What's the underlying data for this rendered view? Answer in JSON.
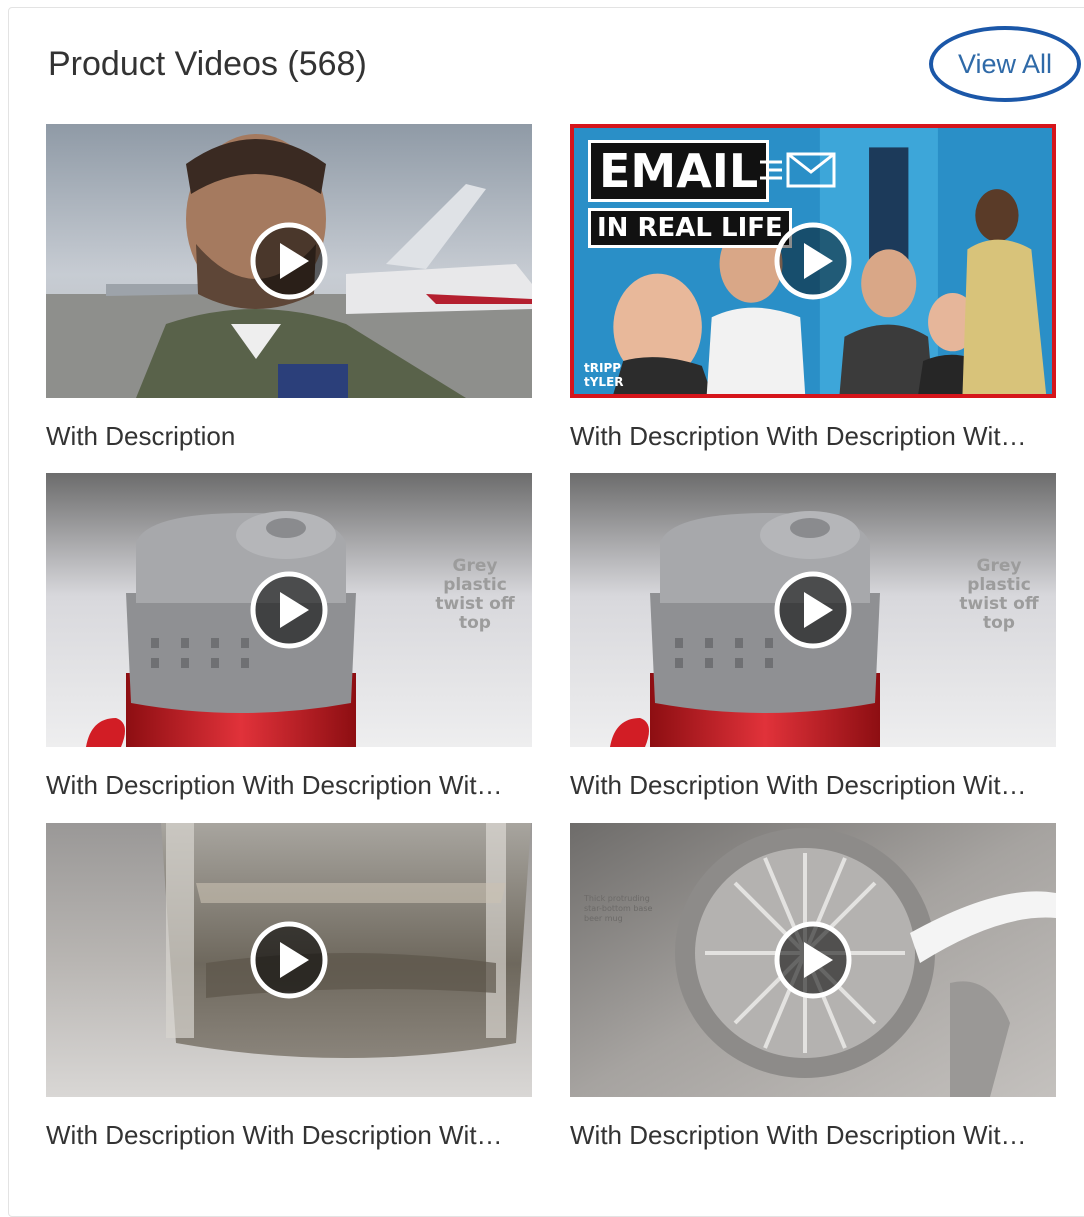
{
  "header": {
    "title": "Product Videos (568)",
    "view_all_label": "View All"
  },
  "colors": {
    "accent": "#1b57a8",
    "link": "#2f6aa8",
    "highlight_border": "#d6151b"
  },
  "videos": [
    {
      "caption": "With Description",
      "thumbnail": "pilot-airfield"
    },
    {
      "caption": "With Description With Description Wit…",
      "thumbnail": "email-in-real-life",
      "overlay": {
        "badge_top": "EMAIL",
        "badge_bottom": "IN REAL LIFE",
        "brand": "tRIPP\ntYLER"
      }
    },
    {
      "caption": "With Description With Description Wit…",
      "thumbnail": "red-bottle-grey-lid",
      "overlay": {
        "note": "Grey plastic\ntwist off top"
      }
    },
    {
      "caption": "With Description With Description Wit…",
      "thumbnail": "red-bottle-grey-lid",
      "overlay": {
        "note": "Grey plastic\ntwist off top"
      }
    },
    {
      "caption": "With Description With Description Wit…",
      "thumbnail": "glass-tumbler"
    },
    {
      "caption": "With Description With Description Wit…",
      "thumbnail": "glass-mug"
    }
  ],
  "icons": {
    "play": "play-icon",
    "envelope": "envelope-icon"
  }
}
